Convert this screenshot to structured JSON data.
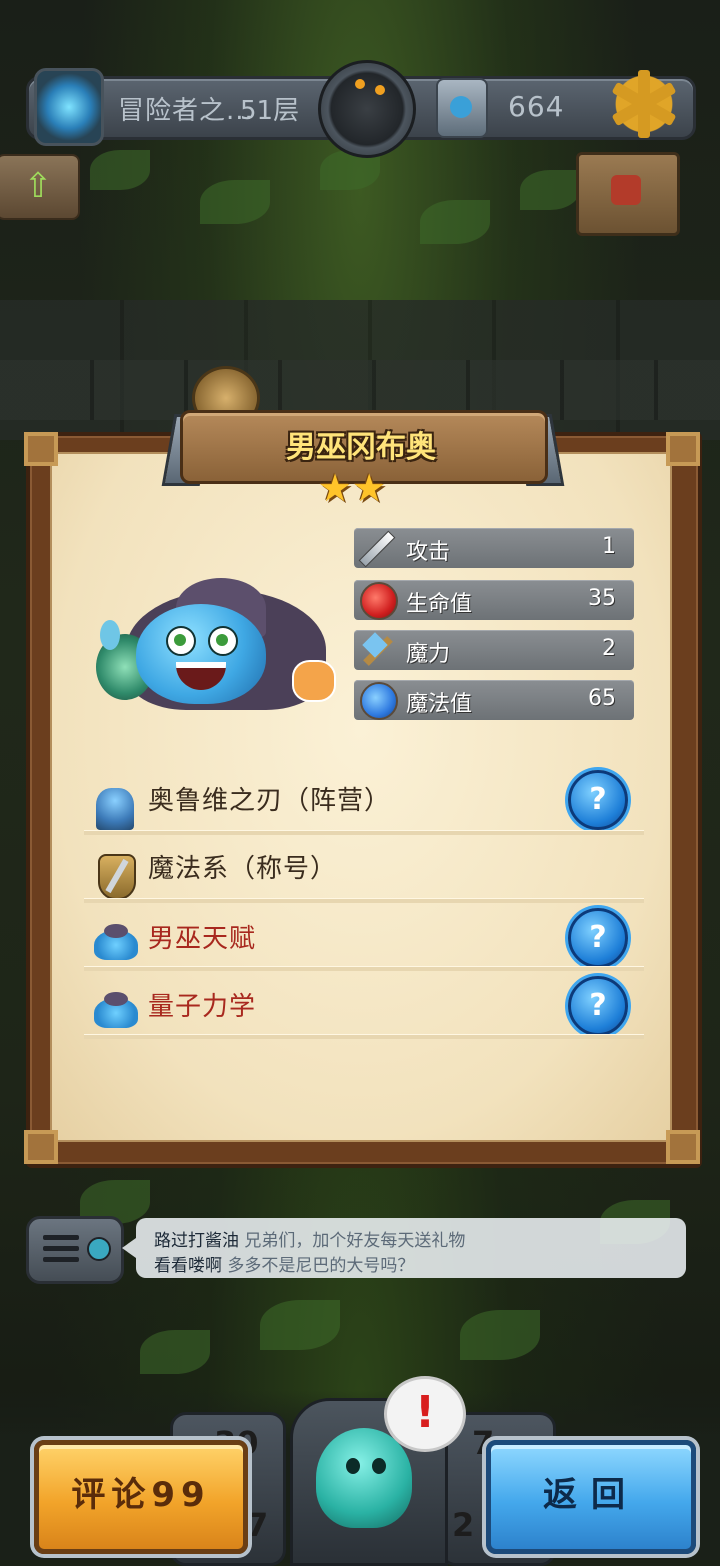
{
  "topbar": {
    "title": "冒险者之...",
    "floor": "51层",
    "count": "664"
  },
  "card": {
    "name": "男巫冈布奥",
    "stars": [
      "★",
      "★"
    ],
    "stats": [
      {
        "icon": "sword-icon",
        "label": "攻击",
        "value": "1"
      },
      {
        "icon": "red-potion-icon",
        "label": "生命值",
        "value": "35"
      },
      {
        "icon": "staff-icon",
        "label": "魔力",
        "value": "2"
      },
      {
        "icon": "blue-potion-icon",
        "label": "魔法值",
        "value": "65"
      }
    ],
    "traits": [
      {
        "icon": "faction-icon",
        "label": "奥鲁维之刃（阵营）",
        "help": "?",
        "highlight": false
      },
      {
        "icon": "title-shield-icon",
        "label": "魔法系（称号）",
        "help": null,
        "highlight": false
      },
      {
        "icon": "wizard-slime-icon",
        "label": "男巫天赋",
        "help": "?",
        "highlight": true
      },
      {
        "icon": "wizard-slime-icon",
        "label": "量子力学",
        "help": "?",
        "highlight": true
      }
    ]
  },
  "chat": {
    "lines": [
      {
        "name": "路过打酱油",
        "message": "兄弟们，加个好友每天送礼物"
      },
      {
        "name": "看看喽啊",
        "message": "多多不是尼巴的大号吗？"
      }
    ]
  },
  "alert": "!",
  "hud": {
    "left_top": "30",
    "left_bottom": "7",
    "right_top": "7",
    "right_bottom": "2"
  },
  "buttons": {
    "comment": "评论99",
    "back": "返回"
  },
  "colors": {
    "title_gold": "#ffe47a",
    "trait_red": "#a8281e",
    "help_blue": "#1e7fd8",
    "comment_button": "#f2a42a",
    "back_button": "#44a8ec"
  }
}
